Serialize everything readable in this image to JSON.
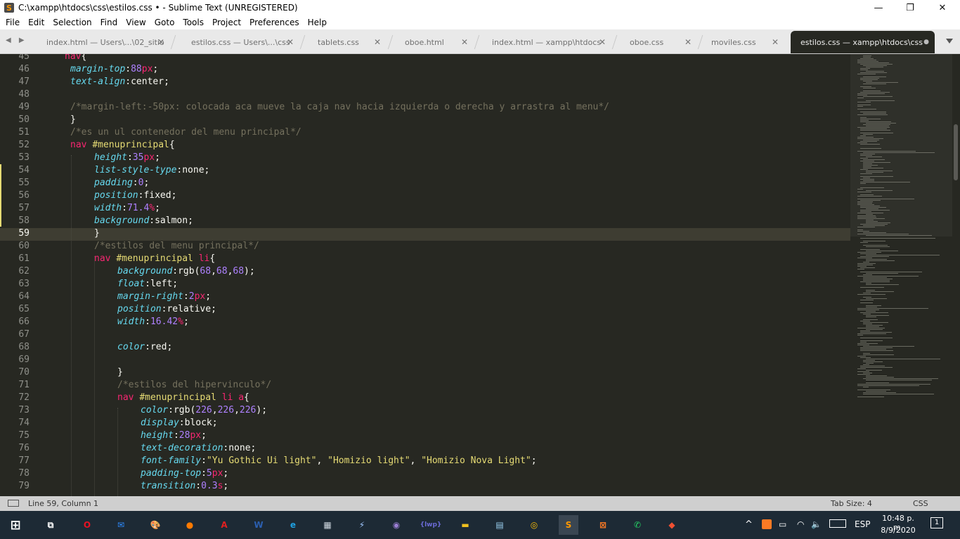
{
  "window": {
    "title": "C:\\xampp\\htdocs\\css\\estilos.css • - Sublime Text (UNREGISTERED)",
    "minimize": "—",
    "maximize": "❐",
    "close": "✕"
  },
  "menu": [
    "File",
    "Edit",
    "Selection",
    "Find",
    "View",
    "Goto",
    "Tools",
    "Project",
    "Preferences",
    "Help"
  ],
  "tabs": [
    {
      "label": "index.html — Users\\...\\02_sitio",
      "close": "✕"
    },
    {
      "label": "estilos.css — Users\\...\\css",
      "close": "✕"
    },
    {
      "label": "tablets.css",
      "close": "✕"
    },
    {
      "label": "oboe.html",
      "close": "✕"
    },
    {
      "label": "index.html — xampp\\htdocs",
      "close": "✕"
    },
    {
      "label": "oboe.css",
      "close": "✕"
    },
    {
      "label": "moviles.css",
      "close": "✕"
    },
    {
      "label": "estilos.css — xampp\\htdocs\\css",
      "close": "●",
      "active": true
    }
  ],
  "tab_nav": "◀ ▶",
  "editor": {
    "current_line": 59,
    "lines": [
      {
        "n": "45",
        "t": [
          [
            "nav",
            "k"
          ],
          [
            "{",
            "w"
          ]
        ]
      },
      {
        "n": "46",
        "t": [
          [
            "margin-top",
            "p"
          ],
          [
            ":",
            "w"
          ],
          [
            "88",
            "n"
          ],
          [
            "px",
            "k"
          ],
          [
            ";",
            "w"
          ]
        ]
      },
      {
        "n": "47",
        "t": [
          [
            "text-align",
            "p"
          ],
          [
            ":",
            "w"
          ],
          [
            "center",
            "w"
          ],
          [
            ";",
            "w"
          ]
        ]
      },
      {
        "n": "48",
        "t": []
      },
      {
        "n": "49",
        "t": [
          [
            "/*margin-left:-50px: colocada aca mueve la caja nav hacia izquierda o derecha y arrastra al menu*/",
            "c"
          ]
        ]
      },
      {
        "n": "50",
        "t": [
          [
            "}",
            "w"
          ]
        ]
      },
      {
        "n": "51",
        "t": [
          [
            "/*es un ul contenedor del menu principal*/",
            "c"
          ]
        ]
      },
      {
        "n": "52",
        "t": [
          [
            "nav ",
            "k"
          ],
          [
            "#menuprincipal",
            "s"
          ],
          [
            "{",
            "w"
          ]
        ]
      },
      {
        "n": "53",
        "t": [
          [
            "height",
            "p"
          ],
          [
            ":",
            "w"
          ],
          [
            "35",
            "n"
          ],
          [
            "px",
            "k"
          ],
          [
            ";",
            "w"
          ]
        ]
      },
      {
        "n": "54",
        "t": [
          [
            "list-style-type",
            "p"
          ],
          [
            ":",
            "w"
          ],
          [
            "none",
            "w"
          ],
          [
            ";",
            "w"
          ]
        ]
      },
      {
        "n": "55",
        "t": [
          [
            "padding",
            "p"
          ],
          [
            ":",
            "w"
          ],
          [
            "0",
            "n"
          ],
          [
            ";",
            "w"
          ]
        ]
      },
      {
        "n": "56",
        "t": [
          [
            "position",
            "p"
          ],
          [
            ":",
            "w"
          ],
          [
            "fixed",
            "w"
          ],
          [
            ";",
            "w"
          ]
        ]
      },
      {
        "n": "57",
        "t": [
          [
            "width",
            "p"
          ],
          [
            ":",
            "w"
          ],
          [
            "71.4",
            "n"
          ],
          [
            "%",
            "k"
          ],
          [
            ";",
            "w"
          ]
        ]
      },
      {
        "n": "58",
        "t": [
          [
            "background",
            "p"
          ],
          [
            ":",
            "w"
          ],
          [
            "salmon",
            "w"
          ],
          [
            ";",
            "w"
          ]
        ]
      },
      {
        "n": "59",
        "t": [
          [
            "}",
            "w"
          ]
        ]
      },
      {
        "n": "60",
        "t": [
          [
            "/*estilos del menu principal*/",
            "c"
          ]
        ]
      },
      {
        "n": "61",
        "t": [
          [
            "nav ",
            "k"
          ],
          [
            "#menuprincipal ",
            "s"
          ],
          [
            "li",
            "k"
          ],
          [
            "{",
            "w"
          ]
        ]
      },
      {
        "n": "62",
        "t": [
          [
            "background",
            "p"
          ],
          [
            ":",
            "w"
          ],
          [
            "rgb",
            "w"
          ],
          [
            "(",
            "w"
          ],
          [
            "68",
            "n"
          ],
          [
            ",",
            "w"
          ],
          [
            "68",
            "n"
          ],
          [
            ",",
            "w"
          ],
          [
            "68",
            "n"
          ],
          [
            ");",
            "w"
          ]
        ]
      },
      {
        "n": "63",
        "t": [
          [
            "float",
            "p"
          ],
          [
            ":",
            "w"
          ],
          [
            "left",
            "w"
          ],
          [
            ";",
            "w"
          ]
        ]
      },
      {
        "n": "64",
        "t": [
          [
            "margin-right",
            "p"
          ],
          [
            ":",
            "w"
          ],
          [
            "2",
            "n"
          ],
          [
            "px",
            "k"
          ],
          [
            ";",
            "w"
          ]
        ]
      },
      {
        "n": "65",
        "t": [
          [
            "position",
            "p"
          ],
          [
            ":",
            "w"
          ],
          [
            "relative",
            "w"
          ],
          [
            ";",
            "w"
          ]
        ]
      },
      {
        "n": "66",
        "t": [
          [
            "width",
            "p"
          ],
          [
            ":",
            "w"
          ],
          [
            "16.42",
            "n"
          ],
          [
            "%",
            "k"
          ],
          [
            ";",
            "w"
          ]
        ]
      },
      {
        "n": "67",
        "t": []
      },
      {
        "n": "68",
        "t": [
          [
            "color",
            "p"
          ],
          [
            ":",
            "w"
          ],
          [
            "red",
            "w"
          ],
          [
            ";",
            "w"
          ]
        ]
      },
      {
        "n": "69",
        "t": []
      },
      {
        "n": "70",
        "t": [
          [
            "}",
            "w"
          ]
        ]
      },
      {
        "n": "71",
        "t": [
          [
            "/*estilos del hipervinculo*/",
            "c"
          ]
        ]
      },
      {
        "n": "72",
        "t": [
          [
            "nav ",
            "k"
          ],
          [
            "#menuprincipal ",
            "s"
          ],
          [
            "li a",
            "k"
          ],
          [
            "{",
            "w"
          ]
        ]
      },
      {
        "n": "73",
        "t": [
          [
            "color",
            "p"
          ],
          [
            ":",
            "w"
          ],
          [
            "rgb",
            "w"
          ],
          [
            "(",
            "w"
          ],
          [
            "226",
            "n"
          ],
          [
            ",",
            "w"
          ],
          [
            "226",
            "n"
          ],
          [
            ",",
            "w"
          ],
          [
            "226",
            "n"
          ],
          [
            ");",
            "w"
          ]
        ]
      },
      {
        "n": "74",
        "t": [
          [
            "display",
            "p"
          ],
          [
            ":",
            "w"
          ],
          [
            "block",
            "w"
          ],
          [
            ";",
            "w"
          ]
        ]
      },
      {
        "n": "75",
        "t": [
          [
            "height",
            "p"
          ],
          [
            ":",
            "w"
          ],
          [
            "28",
            "n"
          ],
          [
            "px",
            "k"
          ],
          [
            ";",
            "w"
          ]
        ]
      },
      {
        "n": "76",
        "t": [
          [
            "text-decoration",
            "p"
          ],
          [
            ":",
            "w"
          ],
          [
            "none",
            "w"
          ],
          [
            ";",
            "w"
          ]
        ]
      },
      {
        "n": "77",
        "t": [
          [
            "font-family",
            "p"
          ],
          [
            ":",
            "w"
          ],
          [
            "\"Yu Gothic Ui light\"",
            "s"
          ],
          [
            ", ",
            "w"
          ],
          [
            "\"Homizio light\"",
            "s"
          ],
          [
            ", ",
            "w"
          ],
          [
            "\"Homizio Nova Light\"",
            "s"
          ],
          [
            ";",
            "w"
          ]
        ]
      },
      {
        "n": "78",
        "t": [
          [
            "padding-top",
            "p"
          ],
          [
            ":",
            "w"
          ],
          [
            "5",
            "n"
          ],
          [
            "px",
            "k"
          ],
          [
            ";",
            "w"
          ]
        ]
      },
      {
        "n": "79",
        "t": [
          [
            "transition",
            "p"
          ],
          [
            ":",
            "w"
          ],
          [
            "0.3",
            "n"
          ],
          [
            "s",
            "k"
          ],
          [
            ";",
            "w"
          ]
        ]
      }
    ]
  },
  "status": {
    "position": "Line 59, Column 1",
    "tab_size": "Tab Size: 4",
    "syntax": "CSS"
  },
  "taskbar": {
    "apps": [
      {
        "name": "task-view",
        "glyph": "⧉"
      },
      {
        "name": "opera",
        "glyph": "O"
      },
      {
        "name": "mail",
        "glyph": "✉"
      },
      {
        "name": "paint",
        "glyph": "🎨"
      },
      {
        "name": "firefox",
        "glyph": "●"
      },
      {
        "name": "acrobat",
        "glyph": "A"
      },
      {
        "name": "word",
        "glyph": "W"
      },
      {
        "name": "edge",
        "glyph": "e"
      },
      {
        "name": "calculator",
        "glyph": "▦"
      },
      {
        "name": "filezilla",
        "glyph": "⚡"
      },
      {
        "name": "github",
        "glyph": "◉"
      },
      {
        "name": "local-wp",
        "glyph": "{lwp}"
      },
      {
        "name": "file-explorer",
        "glyph": "▬"
      },
      {
        "name": "notepad",
        "glyph": "▤"
      },
      {
        "name": "chrome",
        "glyph": "◎"
      },
      {
        "name": "sublime-text",
        "glyph": "S"
      },
      {
        "name": "xampp",
        "glyph": "⊠"
      },
      {
        "name": "whatsapp",
        "glyph": "✆"
      },
      {
        "name": "git",
        "glyph": "◆"
      }
    ],
    "language": "ESP",
    "time": "10:48 p. m.",
    "date": "8/9/2020",
    "notifications": "1"
  },
  "colors": {
    "keyword": "#f92672",
    "property": "#66d9ef",
    "number": "#ae81ff",
    "string": "#e6db74",
    "comment": "#75715e",
    "text": "#f8f8f2",
    "background": "#272822"
  }
}
